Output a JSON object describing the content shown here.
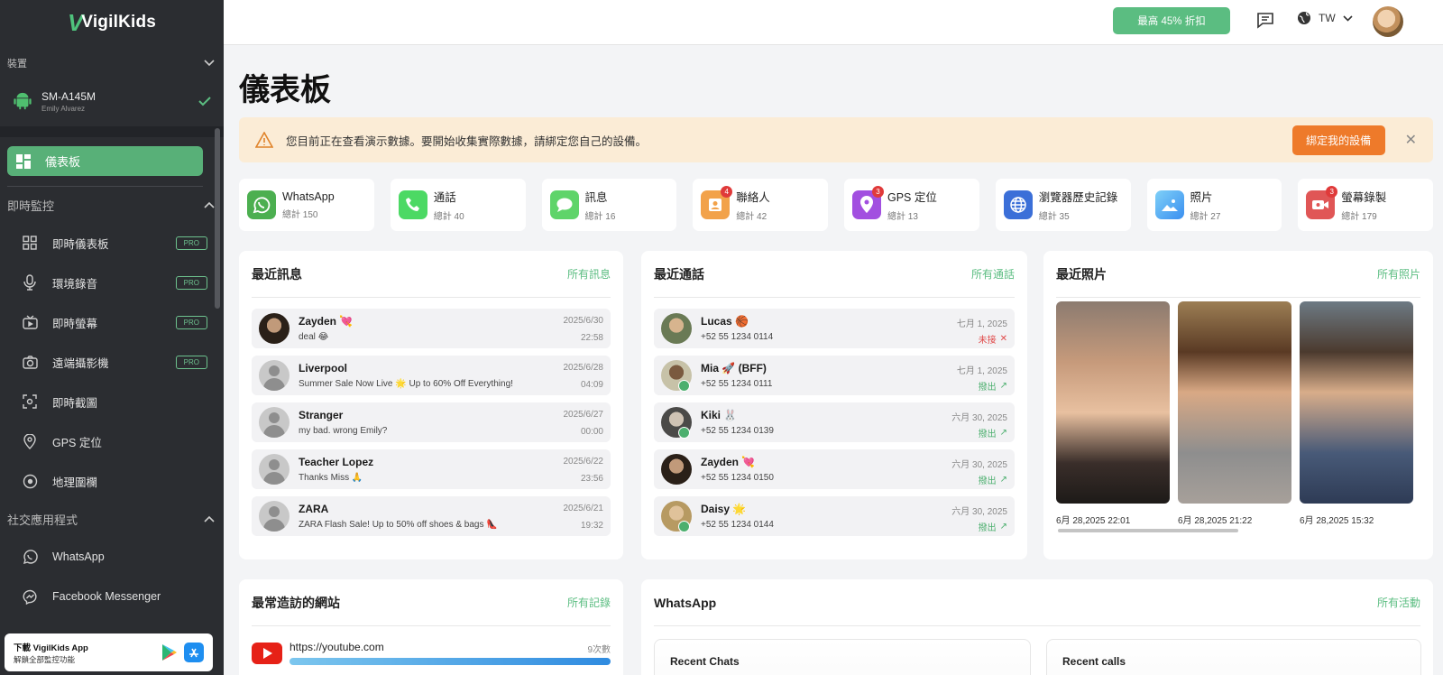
{
  "app": {
    "logo_text": "VigilKids"
  },
  "sidebar": {
    "device_section": "裝置",
    "device": {
      "name": "SM-A145M",
      "owner": "Emily Alvarez"
    },
    "dashboard_label": "儀表板",
    "realtime_section": "即時監控",
    "realtime_items": [
      {
        "label": "即時儀表板",
        "pro": "PRO",
        "icon": "dashboard-grid-icon"
      },
      {
        "label": "環境錄音",
        "pro": "PRO",
        "icon": "microphone-icon"
      },
      {
        "label": "即時螢幕",
        "pro": "PRO",
        "icon": "screen-icon"
      },
      {
        "label": "遠端攝影機",
        "pro": "PRO",
        "icon": "camera-icon"
      },
      {
        "label": "即時截圖",
        "pro": "",
        "icon": "screenshot-icon"
      },
      {
        "label": "GPS 定位",
        "pro": "",
        "icon": "location-pin-icon"
      },
      {
        "label": "地理圍欄",
        "pro": "",
        "icon": "geofence-icon"
      }
    ],
    "social_section": "社交應用程式",
    "social_items": [
      {
        "label": "WhatsApp",
        "icon": "whatsapp-icon"
      },
      {
        "label": "Facebook Messenger",
        "icon": "messenger-icon"
      }
    ],
    "app_banner": {
      "title": "下載 VigilKids App",
      "subtitle": "解鎖全部監控功能"
    }
  },
  "header": {
    "promo_label": "最高 45% 折扣",
    "lang": "TW"
  },
  "page": {
    "title": "儀表板",
    "alert_text": "您目前正在查看演示數據。要開始收集實際數據，請綁定您自己的設備。",
    "alert_button": "綁定我的設備"
  },
  "stats": [
    {
      "name": "WhatsApp",
      "total": "總計 150",
      "badge": "",
      "color": "#4caf50",
      "icon": "whatsapp-icon"
    },
    {
      "name": "通話",
      "total": "總計 40",
      "badge": "",
      "color": "#4cd964",
      "icon": "phone-icon"
    },
    {
      "name": "訊息",
      "total": "總計 16",
      "badge": "",
      "color": "#5fd46a",
      "icon": "message-icon"
    },
    {
      "name": "聯絡人",
      "total": "總計 42",
      "badge": "4",
      "color": "#f2a24a",
      "icon": "contacts-icon"
    },
    {
      "name": "GPS 定位",
      "total": "總計 13",
      "badge": "3",
      "color": "#a24fe0",
      "icon": "location-pin-icon"
    },
    {
      "name": "瀏覽器歷史記錄",
      "total": "總計 35",
      "badge": "",
      "color": "#3b6fd8",
      "icon": "globe-icon"
    },
    {
      "name": "照片",
      "total": "總計 27",
      "badge": "",
      "color": "#4aa8f0",
      "icon": "photo-icon"
    },
    {
      "name": "螢幕錄製",
      "total": "總計 179",
      "badge": "3",
      "color": "#e05656",
      "icon": "video-icon"
    }
  ],
  "messages": {
    "title": "最近訊息",
    "link": "所有訊息",
    "items": [
      {
        "name": "Zayden 💘",
        "text": "deal 😂",
        "date": "2025/6/30",
        "time": "22:58"
      },
      {
        "name": "Liverpool",
        "text": "Summer Sale Now Live 🌟 Up to 60% Off Everything!",
        "date": "2025/6/28",
        "time": "04:09"
      },
      {
        "name": "Stranger",
        "text": "my bad. wrong Emily?",
        "date": "2025/6/27",
        "time": "00:00"
      },
      {
        "name": "Teacher Lopez",
        "text": "Thanks Miss 🙏",
        "date": "2025/6/22",
        "time": "23:56"
      },
      {
        "name": "ZARA",
        "text": "ZARA Flash Sale! Up to 50% off shoes & bags 👠",
        "date": "2025/6/21",
        "time": "19:32"
      }
    ]
  },
  "calls": {
    "title": "最近通話",
    "link": "所有通話",
    "items": [
      {
        "name": "Lucas 🏀",
        "phone": "+52 55 1234 0114",
        "date": "七月 1, 2025",
        "status": "未接",
        "status_color": "#e04a4a"
      },
      {
        "name": "Mia 🚀 (BFF)",
        "phone": "+52 55 1234 0111",
        "date": "七月 1, 2025",
        "status": "撥出",
        "status_color": "#4caf6e"
      },
      {
        "name": "Kiki 🐰",
        "phone": "+52 55 1234 0139",
        "date": "六月 30, 2025",
        "status": "撥出",
        "status_color": "#4caf6e"
      },
      {
        "name": "Zayden 💘",
        "phone": "+52 55 1234 0150",
        "date": "六月 30, 2025",
        "status": "撥出",
        "status_color": "#4caf6e"
      },
      {
        "name": "Daisy 🌟",
        "phone": "+52 55 1234 0144",
        "date": "六月 30, 2025",
        "status": "撥出",
        "status_color": "#4caf6e"
      }
    ]
  },
  "photos": {
    "title": "最近照片",
    "link": "所有照片",
    "items": [
      {
        "caption": "6月 28,2025 22:01"
      },
      {
        "caption": "6月 28,2025 21:22"
      },
      {
        "caption": "6月 28,2025 15:32"
      }
    ]
  },
  "sites": {
    "title": "最常造訪的網站",
    "link": "所有記錄",
    "items": [
      {
        "url": "https://youtube.com",
        "count": "9次數",
        "share": 1.0
      }
    ]
  },
  "whatsapp": {
    "title": "WhatsApp",
    "link": "所有活動",
    "recent_chats": "Recent Chats",
    "recent_calls": "Recent calls"
  }
}
